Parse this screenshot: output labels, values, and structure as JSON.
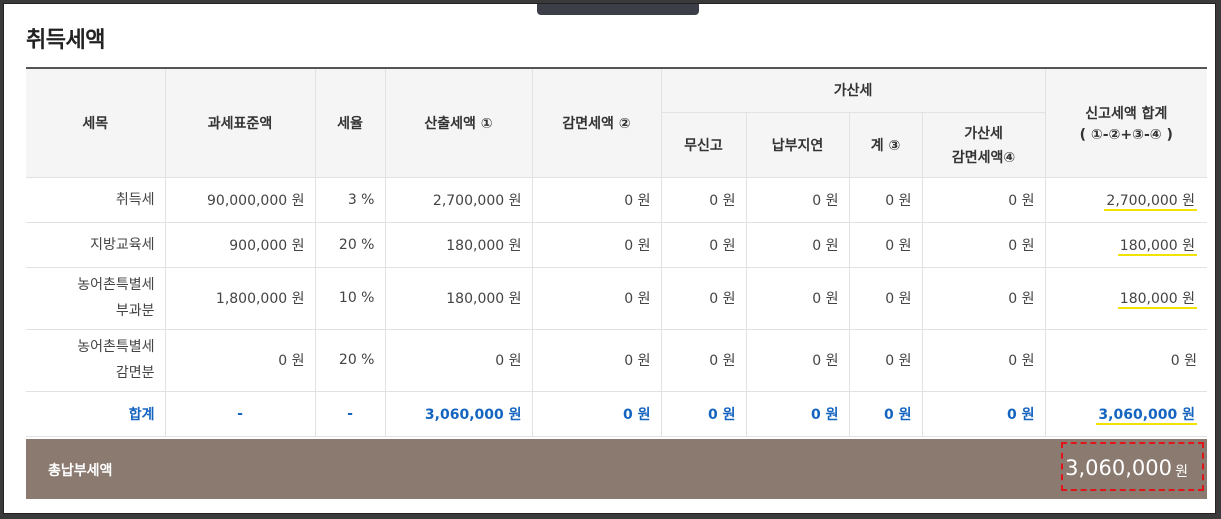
{
  "title": "취득세액",
  "headers": {
    "tax_item": "세목",
    "tax_base": "과세표준액",
    "rate": "세율",
    "computed_tax": "산출세액 ①",
    "reduction": "감면세액 ②",
    "penalty_group": "가산세",
    "penalty_unreported": "무신고",
    "penalty_late": "납부지연",
    "penalty_total": "계 ③",
    "penalty_reduction_line1": "가산세",
    "penalty_reduction_line2": "감면세액④",
    "report_total_line1": "신고세액 합계",
    "report_total_line2": "( ①-②+③-④ )"
  },
  "rows": [
    {
      "name_line1": "취득세",
      "name_line2": "",
      "base": "90,000,000 원",
      "rate": "3 %",
      "computed": "2,700,000 원",
      "reduction": "0 원",
      "unreported": "0 원",
      "late": "0 원",
      "penalty_total": "0 원",
      "penalty_reduction": "0 원",
      "report_total": "2,700,000 원"
    },
    {
      "name_line1": "지방교육세",
      "name_line2": "",
      "base": "900,000 원",
      "rate": "20 %",
      "computed": "180,000 원",
      "reduction": "0 원",
      "unreported": "0 원",
      "late": "0 원",
      "penalty_total": "0 원",
      "penalty_reduction": "0 원",
      "report_total": "180,000 원"
    },
    {
      "name_line1": "농어촌특별세",
      "name_line2": "부과분",
      "base": "1,800,000 원",
      "rate": "10 %",
      "computed": "180,000 원",
      "reduction": "0 원",
      "unreported": "0 원",
      "late": "0 원",
      "penalty_total": "0 원",
      "penalty_reduction": "0 원",
      "report_total": "180,000 원"
    },
    {
      "name_line1": "농어촌특별세",
      "name_line2": "감면분",
      "base": "0 원",
      "rate": "20 %",
      "computed": "0 원",
      "reduction": "0 원",
      "unreported": "0 원",
      "late": "0 원",
      "penalty_total": "0 원",
      "penalty_reduction": "0 원",
      "report_total": "0 원"
    }
  ],
  "total_row": {
    "name": "합계",
    "base": "-",
    "rate": "-",
    "computed": "3,060,000 원",
    "reduction": "0 원",
    "unreported": "0 원",
    "late": "0 원",
    "penalty_total": "0 원",
    "penalty_reduction": "0 원",
    "report_total": "3,060,000 원"
  },
  "summary": {
    "label": "총납부세액",
    "amount": "3,060,000",
    "unit": "원"
  },
  "colors": {
    "total_text": "#1565c0",
    "summary_bg": "#8a7a70",
    "highlight_box": "#e1141a",
    "underline_highlight": "#f2e200"
  }
}
